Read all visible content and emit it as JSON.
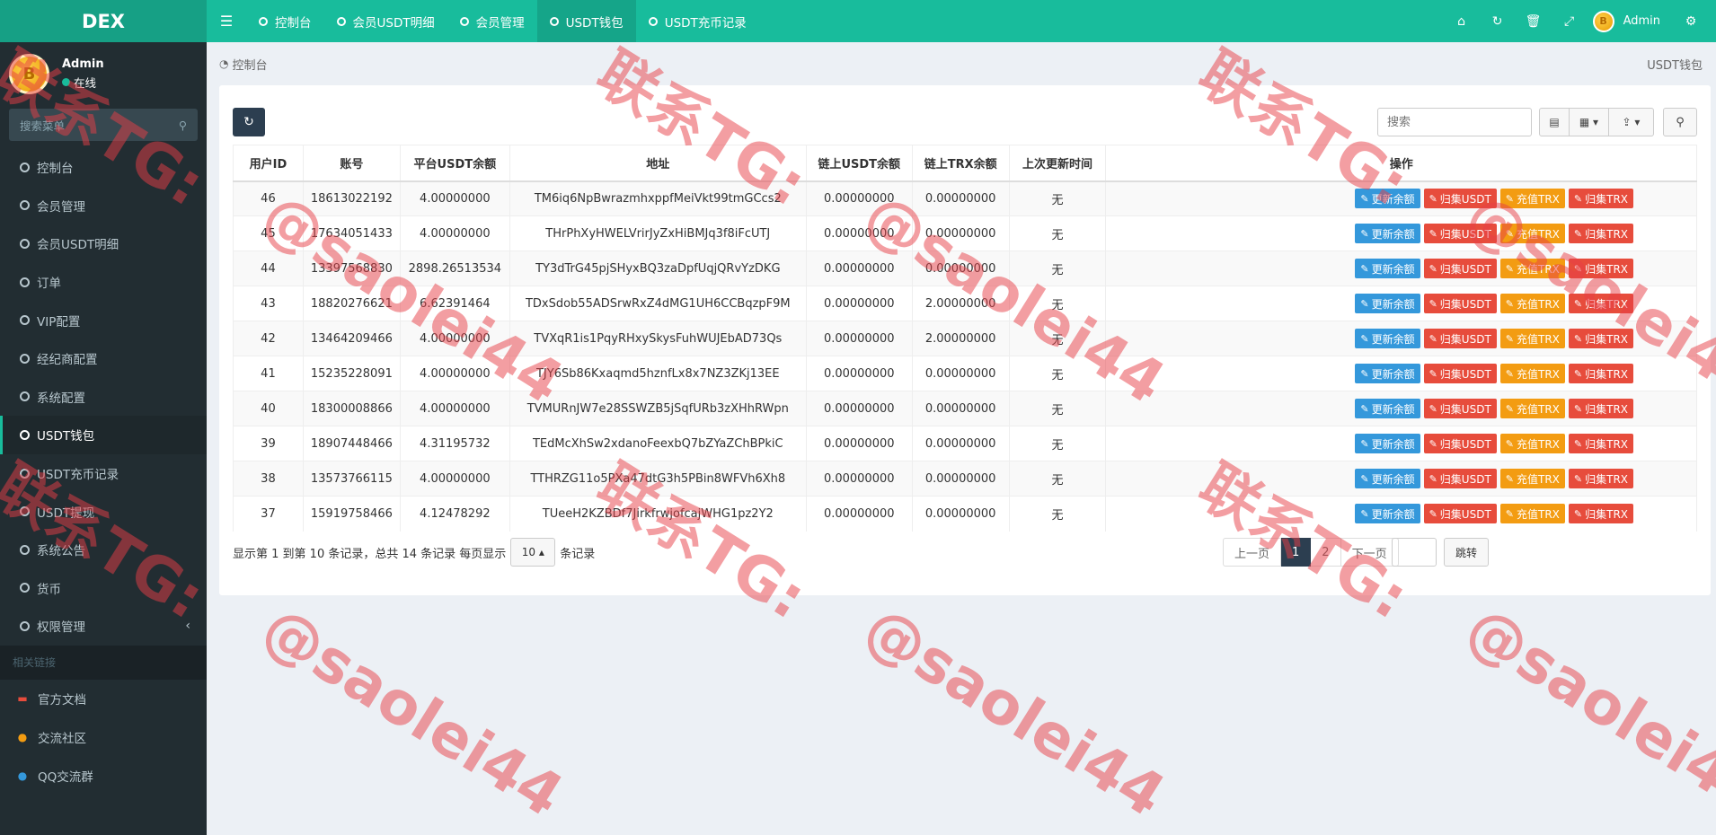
{
  "app": {
    "logo": "DEX"
  },
  "topnav": {
    "tabs": [
      {
        "label": "控制台"
      },
      {
        "label": "会员USDT明细"
      },
      {
        "label": "会员管理"
      },
      {
        "label": "USDT钱包"
      },
      {
        "label": "USDT充币记录"
      }
    ],
    "user": "Admin",
    "avatar_text": "B"
  },
  "sidebar": {
    "user": "Admin",
    "status": "在线",
    "avatar_text": "B",
    "search_placeholder": "搜索菜单",
    "items": [
      {
        "label": "控制台"
      },
      {
        "label": "会员管理"
      },
      {
        "label": "会员USDT明细"
      },
      {
        "label": "订单"
      },
      {
        "label": "VIP配置"
      },
      {
        "label": "经纪商配置"
      },
      {
        "label": "系统配置"
      },
      {
        "label": "USDT钱包"
      },
      {
        "label": "USDT充币记录"
      },
      {
        "label": "USDT提现"
      },
      {
        "label": "系统公告"
      },
      {
        "label": "货币"
      },
      {
        "label": "权限管理"
      }
    ],
    "section_header": "相关链接",
    "links": [
      {
        "label": "官方文档",
        "color": "#e74c3c"
      },
      {
        "label": "交流社区",
        "color": "#f39c12"
      },
      {
        "label": "QQ交流群",
        "color": "#3498db"
      }
    ]
  },
  "breadcrumb": {
    "home": "控制台",
    "current": "USDT钱包"
  },
  "toolbar": {
    "search_placeholder": "搜索"
  },
  "table": {
    "headers": [
      "用户ID",
      "账号",
      "平台USDT余额",
      "地址",
      "链上USDT余额",
      "链上TRX余额",
      "上次更新时间",
      "操作"
    ],
    "actions": [
      "更新余额",
      "归集USDT",
      "充值TRX",
      "归集TRX"
    ],
    "rows": [
      [
        "46",
        "18613022192",
        "4.00000000",
        "TM6iq6NpBwrazmhxppfMeiVkt99tmGCcs2",
        "0.00000000",
        "0.00000000",
        "无"
      ],
      [
        "45",
        "17634051433",
        "4.00000000",
        "THrPhXyHWELVrirJyZxHiBMJq3f8iFcUTJ",
        "0.00000000",
        "0.00000000",
        "无"
      ],
      [
        "44",
        "13397568830",
        "2898.26513534",
        "TY3dTrG45pjSHyxBQ3zaDpfUqjQRvYzDKG",
        "0.00000000",
        "0.00000000",
        "无"
      ],
      [
        "43",
        "18820276621",
        "6.62391464",
        "TDxSdob55ADSrwRxZ4dMG1UH6CCBqzpF9M",
        "0.00000000",
        "2.00000000",
        "无"
      ],
      [
        "42",
        "13464209466",
        "4.00000000",
        "TVXqR1is1PqyRHxySkysFuhWUJEbAD73Qs",
        "0.00000000",
        "2.00000000",
        "无"
      ],
      [
        "41",
        "15235228091",
        "4.00000000",
        "TJY6Sb86Kxaqmd5hznfLx8x7NZ3ZKj13EE",
        "0.00000000",
        "0.00000000",
        "无"
      ],
      [
        "40",
        "18300008866",
        "4.00000000",
        "TVMURnJW7e28SSWZB5jSqfURb3zXHhRWpn",
        "0.00000000",
        "0.00000000",
        "无"
      ],
      [
        "39",
        "18907448466",
        "4.31195732",
        "TEdMcXhSw2xdanoFeexbQ7bZYaZChBPkiC",
        "0.00000000",
        "0.00000000",
        "无"
      ],
      [
        "38",
        "13573766115",
        "4.00000000",
        "TTHRZG11o5PXa47dtG3h5PBin8WFVh6Xh8",
        "0.00000000",
        "0.00000000",
        "无"
      ],
      [
        "37",
        "15919758466",
        "4.12478292",
        "TUeeH2KZBDf7JirkfrwjofcajWHG1pz2Y2",
        "0.00000000",
        "0.00000000",
        "无"
      ]
    ]
  },
  "pagination": {
    "summary": "显示第 1 到第 10 条记录，总共 14 条记录 每页显示",
    "page_size": "10",
    "suffix": "条记录",
    "prev": "上一页",
    "pages": [
      "1",
      "2"
    ],
    "next": "下一页",
    "jump": "跳转"
  },
  "watermark": {
    "line1": "联系TG:",
    "line2": "@saolei44"
  }
}
